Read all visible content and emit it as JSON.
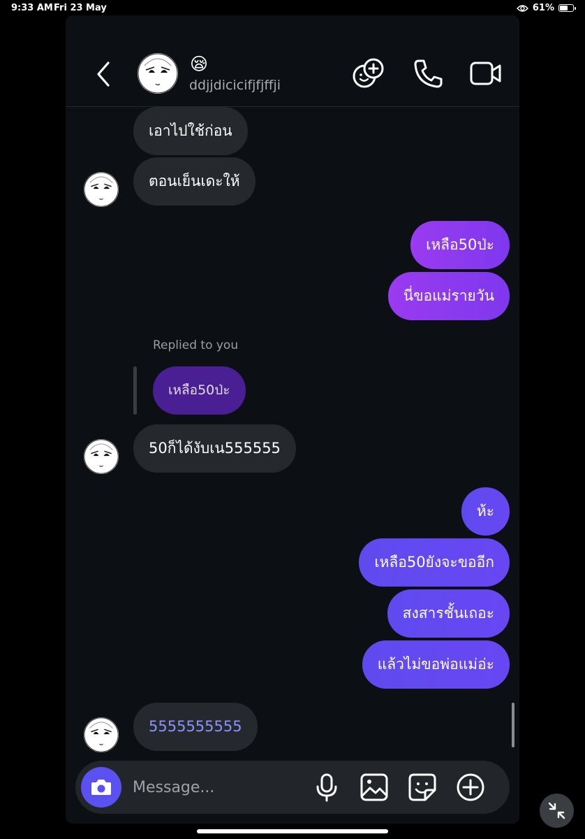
{
  "status_bar": {
    "time": "9:33 AM",
    "date": "Fri 23 May",
    "battery": "61%"
  },
  "header": {
    "back_icon": "chevron-left-icon",
    "emoji": "😪",
    "username": "ddjjdicicifjfjffji",
    "actions": [
      "add-people-icon",
      "phone-icon",
      "video-call-icon"
    ]
  },
  "messages": [
    {
      "text": "เอาไปใช้ก่อน",
      "from": "them"
    },
    {
      "text": "ตอนเย็นเดะให้",
      "from": "them"
    },
    {
      "text": "เหลือ50ป่ะ",
      "from": "me"
    },
    {
      "text": "นี่ขอแม่รายวัน",
      "from": "me"
    },
    {
      "reply_label": "Replied to you",
      "quoted": "เหลือ50ป่ะ"
    },
    {
      "text": "50ก็ได้งับเน555555",
      "from": "them"
    },
    {
      "text": "ห้ะ",
      "from": "me"
    },
    {
      "text": "เหลือ50ยังจะขออีก",
      "from": "me"
    },
    {
      "text": "สงสารชั้นเถอะ",
      "from": "me"
    },
    {
      "text": "แล้วไม่ขอพ่อแม่อ่ะ",
      "from": "me"
    },
    {
      "text": "5555555555",
      "from": "them",
      "link_style": true
    }
  ],
  "composer": {
    "placeholder": "Message...",
    "icons": [
      "camera-icon",
      "microphone-icon",
      "image-icon",
      "sticker-icon",
      "plus-circle-icon"
    ]
  },
  "colors": {
    "incoming_bubble": "#25282d",
    "outgoing_purple": "#8b3af0",
    "outgoing_blue": "#6448f1",
    "quoted_bubble": "#4a1f93",
    "camera_button": "#5b51f0",
    "background": "#0c0f13"
  }
}
